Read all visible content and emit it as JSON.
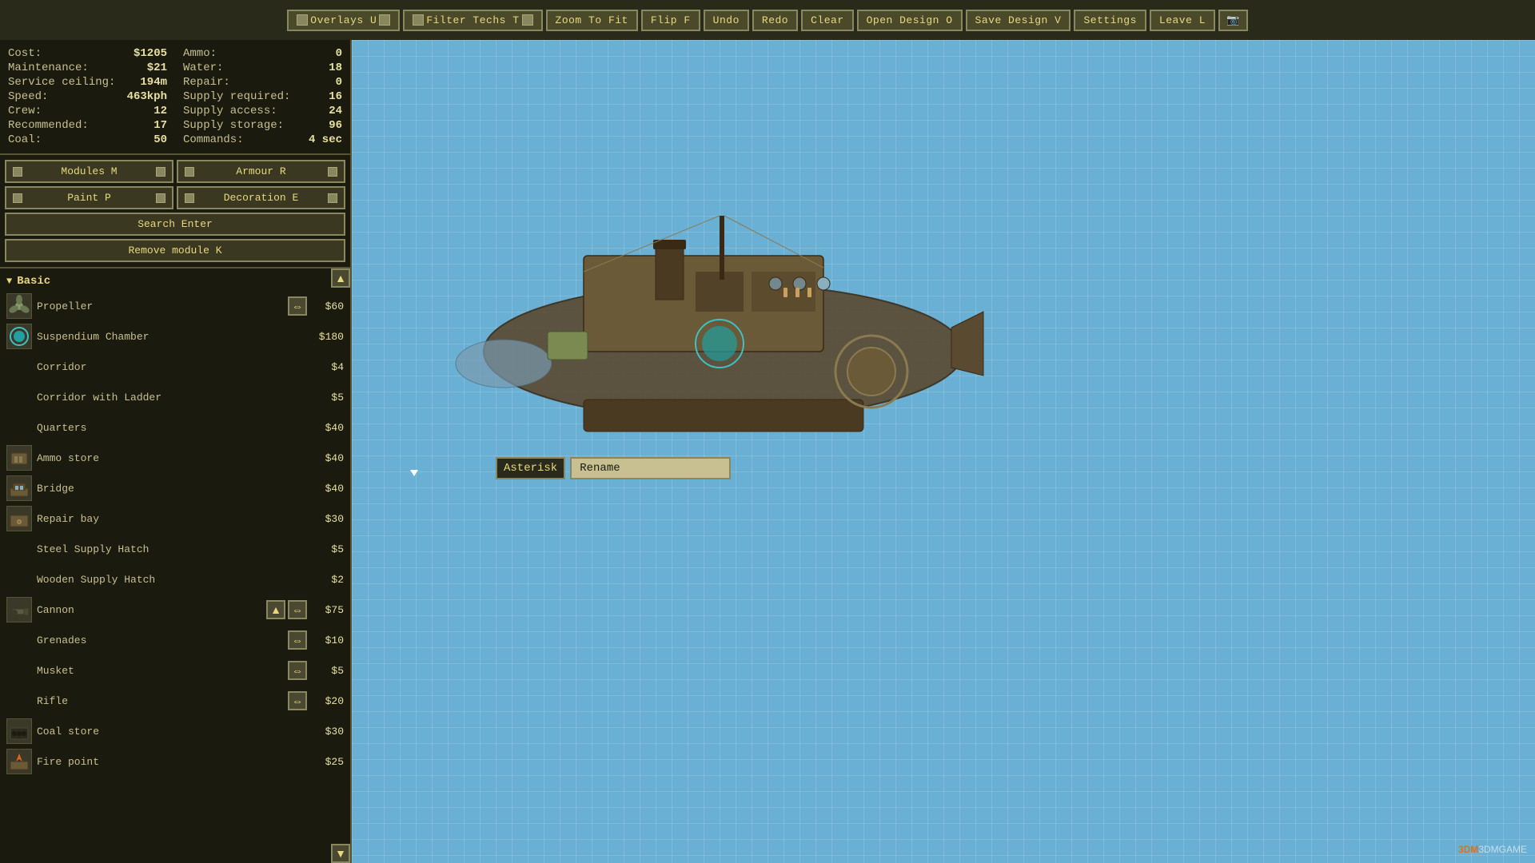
{
  "toolbar": {
    "buttons": [
      {
        "id": "overlays",
        "label": "Overlays U",
        "has_indicator": true
      },
      {
        "id": "filter-techs",
        "label": "Filter Techs T",
        "has_indicator": true
      },
      {
        "id": "zoom-to-fit",
        "label": "Zoom to fit",
        "has_indicator": false
      },
      {
        "id": "flip",
        "label": "Flip F",
        "has_indicator": false
      },
      {
        "id": "undo",
        "label": "Undo",
        "has_indicator": false
      },
      {
        "id": "redo",
        "label": "Redo",
        "has_indicator": false
      },
      {
        "id": "clear",
        "label": "Clear",
        "has_indicator": false
      },
      {
        "id": "open-design",
        "label": "Open design O",
        "has_indicator": false
      },
      {
        "id": "save-design",
        "label": "Save design V",
        "has_indicator": false
      },
      {
        "id": "settings",
        "label": "Settings",
        "has_indicator": false
      },
      {
        "id": "leave",
        "label": "Leave L",
        "has_indicator": false
      }
    ]
  },
  "stats": {
    "left_col": [
      {
        "label": "Cost:",
        "value": "$1205"
      },
      {
        "label": "Maintenance:",
        "value": "$21"
      },
      {
        "label": "Service ceiling:",
        "value": "194m"
      },
      {
        "label": "Speed:",
        "value": "463kph"
      },
      {
        "label": "Crew:",
        "value": "12"
      },
      {
        "label": "Recommended:",
        "value": "17"
      },
      {
        "label": "Coal:",
        "value": "50"
      }
    ],
    "right_col": [
      {
        "label": "Ammo:",
        "value": "0"
      },
      {
        "label": "Water:",
        "value": "18"
      },
      {
        "label": "Repair:",
        "value": "0"
      },
      {
        "label": "Supply required:",
        "value": "16"
      },
      {
        "label": "Supply access:",
        "value": "24"
      },
      {
        "label": "Supply storage:",
        "value": "96"
      },
      {
        "label": "Commands:",
        "value": "4 sec"
      }
    ]
  },
  "category_buttons": {
    "modules": "Modules M",
    "armour": "Armour R",
    "paint": "Paint P",
    "decoration": "Decoration E",
    "search": "Search Enter",
    "remove": "Remove module K"
  },
  "modules": {
    "section_label": "Basic",
    "items": [
      {
        "name": "Propeller",
        "cost": "$60",
        "has_icon": true,
        "has_flip": true
      },
      {
        "name": "Suspendium Chamber",
        "cost": "$180",
        "has_icon": true,
        "has_flip": false
      },
      {
        "name": "Corridor",
        "cost": "$4",
        "has_icon": false,
        "has_flip": false
      },
      {
        "name": "Corridor with Ladder",
        "cost": "$5",
        "has_icon": false,
        "has_flip": false
      },
      {
        "name": "Quarters",
        "cost": "$40",
        "has_icon": false,
        "has_flip": false
      },
      {
        "name": "Ammo store",
        "cost": "$40",
        "has_icon": true,
        "has_flip": false
      },
      {
        "name": "Bridge",
        "cost": "$40",
        "has_icon": true,
        "has_flip": false
      },
      {
        "name": "Repair bay",
        "cost": "$30",
        "has_icon": true,
        "has_flip": false
      },
      {
        "name": "Steel Supply Hatch",
        "cost": "$5",
        "has_icon": false,
        "has_flip": false
      },
      {
        "name": "Wooden Supply Hatch",
        "cost": "$2",
        "has_icon": false,
        "has_flip": false
      },
      {
        "name": "Cannon",
        "cost": "$75",
        "has_icon": true,
        "has_flip": true,
        "has_up": true
      },
      {
        "name": "Grenades",
        "cost": "$10",
        "has_icon": false,
        "has_flip": true
      },
      {
        "name": "Musket",
        "cost": "$5",
        "has_icon": false,
        "has_flip": true
      },
      {
        "name": "Rifle",
        "cost": "$20",
        "has_icon": false,
        "has_flip": true
      },
      {
        "name": "Coal store",
        "cost": "$30",
        "has_icon": true,
        "has_flip": false
      },
      {
        "name": "Fire point",
        "cost": "$25",
        "has_icon": true,
        "has_flip": false
      }
    ]
  },
  "rename_dialog": {
    "label": "Asterisk",
    "button": "Rename",
    "placeholder": ""
  },
  "watermark": "3DMGAME"
}
